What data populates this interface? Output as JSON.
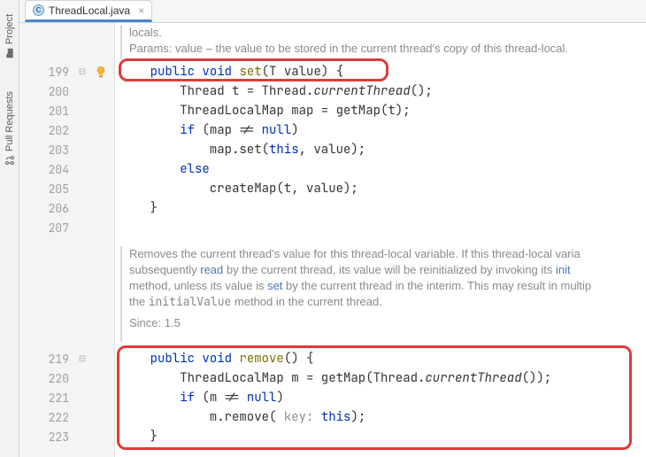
{
  "sideTabs": {
    "project": "Project",
    "pull": "Pull Requests"
  },
  "fileTab": {
    "iconLetter": "C",
    "name": "ThreadLocal.java",
    "close": "×"
  },
  "doc1": {
    "line0": "locals.",
    "paramsLabel": "Params:",
    "paramsText": " value – the value to be stored in the current thread's copy of this thread-local."
  },
  "code": {
    "l199": {
      "kw1": "public",
      "kw2": "void",
      "name": "set",
      "sig": "(T value) {"
    },
    "l200": "        Thread t = Thread.currentThread();",
    "l201": "        ThreadLocalMap map = getMap(t);",
    "l202_a": "        ",
    "l202_kw": "if",
    "l202_b": " (map != ",
    "l202_kw2": "null",
    "l202_c": ")",
    "l203_a": "            map.set(",
    "l203_kw": "this",
    "l203_b": ", value);",
    "l204_a": "        ",
    "l204_kw": "else",
    "l205": "            createMap(t, value);",
    "l206": "    }",
    "l219": {
      "kw1": "public",
      "kw2": "void",
      "name": "remove",
      "sig": "() {"
    },
    "l220_a": "        ThreadLocalMap m = getMap(Thread.",
    "l220_m": "currentThread",
    "l220_b": "());",
    "l221_a": "        ",
    "l221_kw": "if",
    "l221_b": " (m != ",
    "l221_kw2": "null",
    "l221_c": ")",
    "l222_a": "            m.remove( ",
    "l222_hint": "key:",
    "l222_b": " ",
    "l222_kw": "this",
    "l222_c": ");",
    "l223": "    }"
  },
  "doc2": {
    "t1": "Removes the current thread's value for this thread-local variable. If this thread-local varia",
    "t2a": "subsequently ",
    "read": "read",
    "t2b": " by the current thread, its value will be reinitialized by invoking its ",
    "init": "init",
    "t3a": "method, unless its value is ",
    "set": "set",
    "t3b": " by the current thread in the interim. This may result in multip",
    "t4a": "the ",
    "iv": "initialValue",
    "t4b": " method in the current thread.",
    "since": "Since: 1.5"
  },
  "lineNums": {
    "n199": "199",
    "n200": "200",
    "n201": "201",
    "n202": "202",
    "n203": "203",
    "n204": "204",
    "n205": "205",
    "n206": "206",
    "n207": "207",
    "n219": "219",
    "n220": "220",
    "n221": "221",
    "n222": "222",
    "n223": "223"
  },
  "fold": {
    "minus": "⊟"
  }
}
